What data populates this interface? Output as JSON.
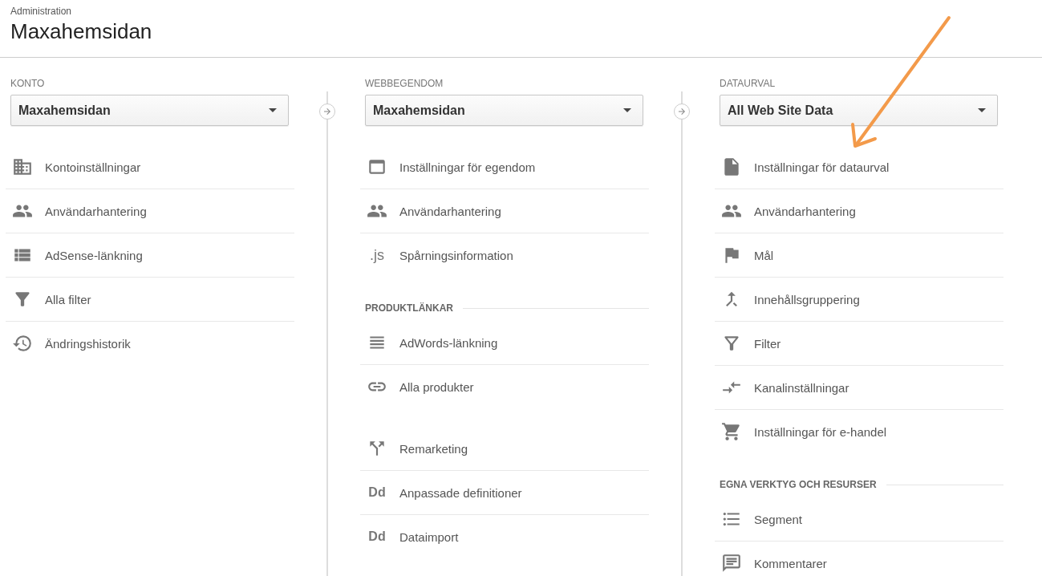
{
  "header": {
    "breadcrumb": "Administration",
    "title": "Maxahemsidan"
  },
  "columns": [
    {
      "label": "KONTO",
      "dropdown": "Maxahemsidan",
      "sections": [
        {
          "items": [
            {
              "label": "Kontoinställningar"
            },
            {
              "label": "Användarhantering"
            },
            {
              "label": "AdSense-länkning"
            },
            {
              "label": "Alla filter"
            },
            {
              "label": "Ändringshistorik"
            }
          ]
        }
      ]
    },
    {
      "label": "WEBBEGENDOM",
      "dropdown": "Maxahemsidan",
      "sections": [
        {
          "items": [
            {
              "label": "Inställningar för egendom"
            },
            {
              "label": "Användarhantering"
            },
            {
              "label": "Spårningsinformation",
              "glyph": ".js"
            }
          ]
        },
        {
          "heading": "PRODUKTLÄNKAR",
          "items": [
            {
              "label": "AdWords-länkning"
            },
            {
              "label": "Alla produkter"
            }
          ]
        },
        {
          "items": [
            {
              "label": "Remarketing"
            },
            {
              "label": "Anpassade definitioner",
              "glyph": "Dd"
            },
            {
              "label": "Dataimport",
              "glyph": "Dd"
            }
          ]
        }
      ]
    },
    {
      "label": "DATAURVAL",
      "dropdown": "All Web Site Data",
      "sections": [
        {
          "items": [
            {
              "label": "Inställningar för dataurval"
            },
            {
              "label": "Användarhantering"
            },
            {
              "label": "Mål"
            },
            {
              "label": "Innehållsgruppering"
            },
            {
              "label": "Filter"
            },
            {
              "label": "Kanalinställningar"
            },
            {
              "label": "Inställningar för e-handel"
            }
          ]
        },
        {
          "heading": "EGNA VERKTYG OCH RESURSER",
          "items": [
            {
              "label": "Segment"
            },
            {
              "label": "Kommentarer"
            }
          ]
        }
      ]
    }
  ]
}
